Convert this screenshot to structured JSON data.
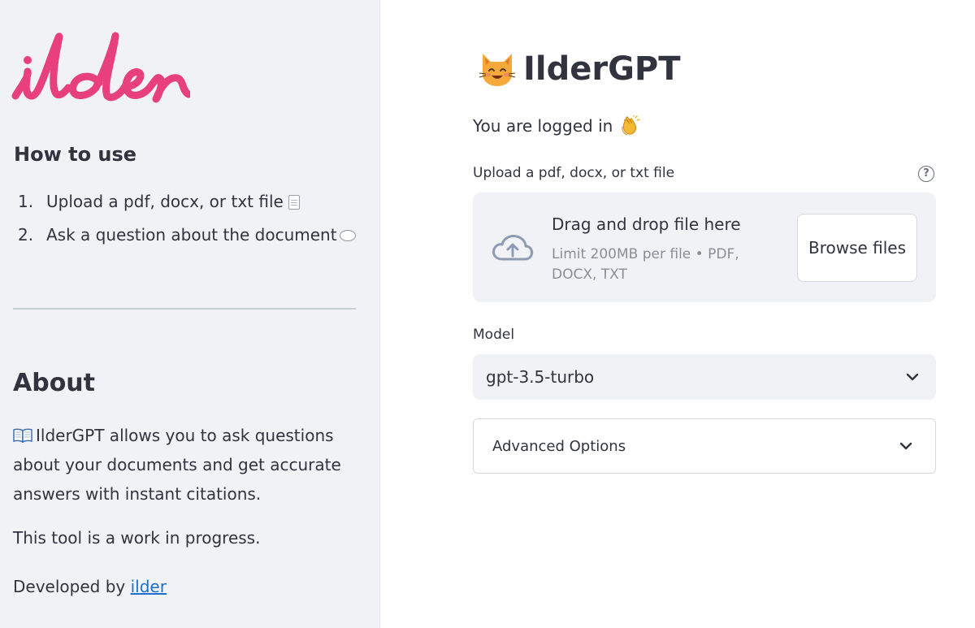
{
  "sidebar": {
    "logo_text": "ilder",
    "how_to_title": "How to use",
    "steps": [
      {
        "num": "1.",
        "text": "Upload a pdf, docx, or txt file",
        "icon": "document-icon"
      },
      {
        "num": "2.",
        "text": "Ask a question about the document",
        "icon": "speech-bubble-icon"
      }
    ],
    "about_title": "About",
    "about_text": "IlderGPT allows you to ask questions about your documents and get accurate answers with instant citations.",
    "about_icon": "open-book-icon",
    "progress_text": "This tool is a work in progress.",
    "developed_prefix": "Developed by ",
    "developed_link": "ilder"
  },
  "main": {
    "title": "IlderGPT",
    "title_icon": "smiling-cat-icon",
    "logged_in_text": "You are logged in",
    "logged_in_icon": "clapping-hands-icon",
    "uploader": {
      "label": "Upload a pdf, docx, or txt file",
      "help_symbol": "?",
      "drag_text": "Drag and drop file here",
      "limit_text": "Limit 200MB per file • PDF, DOCX, TXT",
      "browse_label": "Browse files",
      "icon": "cloud-upload-icon"
    },
    "model": {
      "label": "Model",
      "selected": "gpt-3.5-turbo"
    },
    "advanced": {
      "label": "Advanced Options"
    }
  },
  "colors": {
    "sidebar_bg": "#f0f2f6",
    "text": "#31333f",
    "brand_pink": "#e8407a",
    "link": "#1c6fd1",
    "muted": "#8b8e97"
  }
}
